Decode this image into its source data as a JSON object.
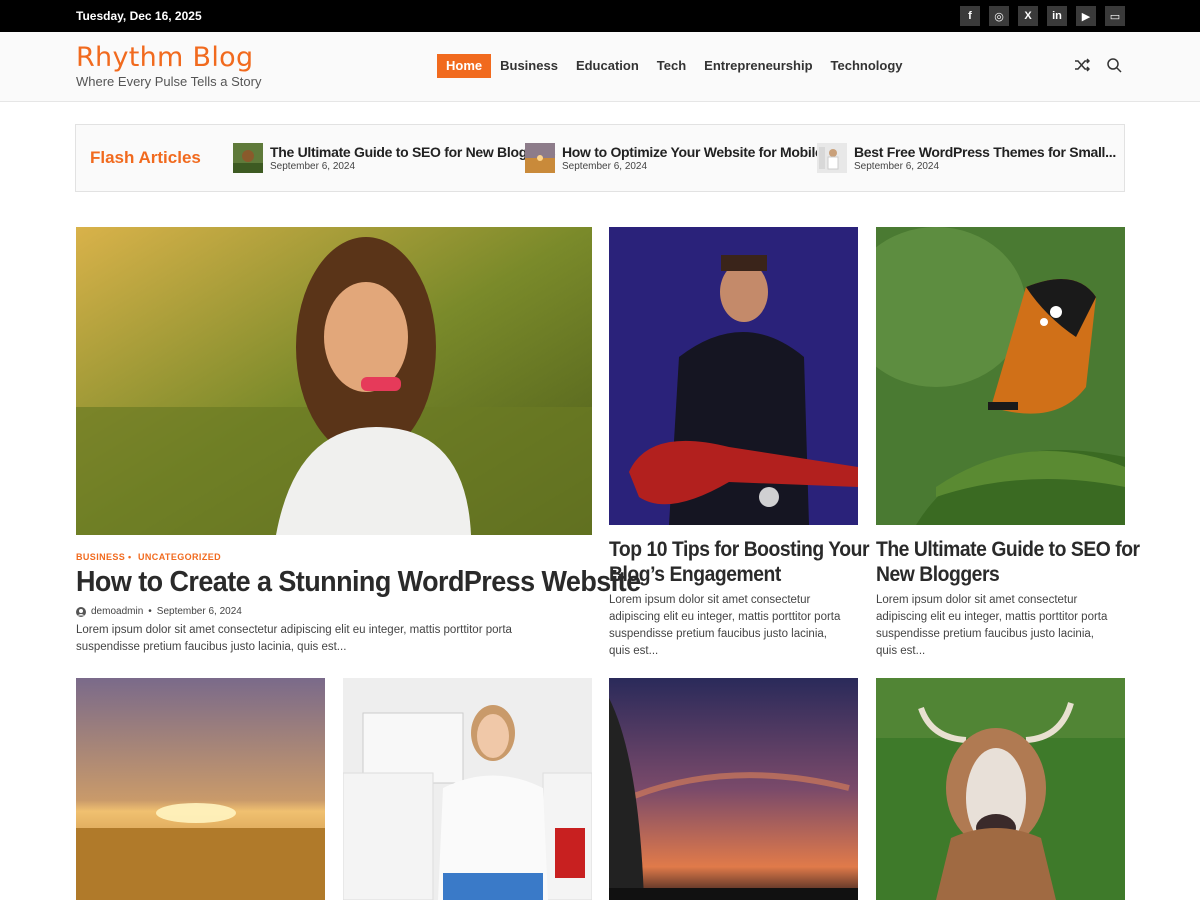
{
  "topbar": {
    "date": "Tuesday, Dec 16, 2025",
    "social": [
      {
        "icon": "facebook-icon",
        "glyph": "f"
      },
      {
        "icon": "instagram-icon",
        "glyph": "◎"
      },
      {
        "icon": "x-icon",
        "glyph": "X"
      },
      {
        "icon": "linkedin-icon",
        "glyph": "in"
      },
      {
        "icon": "youtube-icon",
        "glyph": "▶"
      },
      {
        "icon": "twitch-icon",
        "glyph": "▭"
      }
    ]
  },
  "header": {
    "site_title": "Rhythm Blog",
    "tagline": "Where Every Pulse Tells a Story",
    "nav": [
      "Home",
      "Business",
      "Education",
      "Tech",
      "Entrepreneurship",
      "Technology"
    ],
    "accent_color": "#f16a1e"
  },
  "flash": {
    "label": "Flash Articles",
    "items": [
      {
        "title": "The Ultimate Guide to SEO for New Bloggers",
        "date": "September 6, 2024"
      },
      {
        "title": "How to Optimize Your Website for Mobile...",
        "date": "September 6, 2024"
      },
      {
        "title": "Best Free WordPress Themes for Small...",
        "date": "September 6, 2024"
      }
    ]
  },
  "featured": {
    "categories": [
      "BUSINESS",
      "UNCATEGORIZED"
    ],
    "title": "How to Create a Stunning WordPress Website",
    "author": "demoadmin",
    "date": "September 6, 2024",
    "excerpt_line1": "Lorem ipsum dolor sit amet consectetur adipiscing elit eu integer, mattis porttitor porta",
    "excerpt_line2": "suspendisse pretium faucibus justo lacinia, quis est..."
  },
  "cards": [
    {
      "title_line1": "Top 10 Tips for Boosting Your",
      "title_line2": "Blog’s Engagement",
      "excerpt": [
        "Lorem ipsum dolor sit amet consectetur",
        "adipiscing elit eu integer, mattis porttitor porta",
        "suspendisse pretium faucibus justo lacinia,",
        "quis est..."
      ]
    },
    {
      "title_line1": "The Ultimate Guide to SEO for",
      "title_line2": "New Bloggers",
      "excerpt": [
        "Lorem ipsum dolor sit amet consectetur",
        "adipiscing elit eu integer, mattis porttitor porta",
        "suspendisse pretium faucibus justo lacinia,",
        "quis est..."
      ]
    }
  ]
}
